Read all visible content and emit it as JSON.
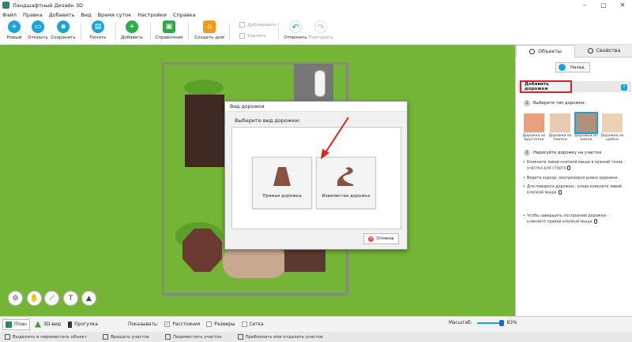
{
  "window": {
    "title": "Ландшафтный Дизайн 3D"
  },
  "menu": [
    "Файл",
    "Правка",
    "Добавить",
    "Вид",
    "Время суток",
    "Настройки",
    "Справка"
  ],
  "toolbar": {
    "new": "Новый",
    "open": "Открыть",
    "save": "Сохранить",
    "print": "Печать",
    "add": "Добавить",
    "reference": "Справочник",
    "create_house": "Создать дом",
    "duplicate": "Дублировать",
    "delete": "Удалить",
    "undo": "Отменить",
    "redo": "Повторить"
  },
  "dialog": {
    "title": "Вид дорожки",
    "heading": "Выберите вид дорожки:",
    "option_straight": "Прямая дорожка",
    "option_curved": "Извилистая дорожка",
    "cancel": "Отмена"
  },
  "right_panel": {
    "tab_objects": "Объекты",
    "tab_properties": "Свойства",
    "back": "Назад",
    "section_title": "Добавить дорожки",
    "step1": "Выберите тип дорожки:",
    "step2": "Нарисуйте дорожку на участке",
    "path_types": [
      {
        "label": "Дорожка из брусчатки",
        "color": "#e8a07a"
      },
      {
        "label": "Дорожка из плитки",
        "color": "#e6cbb0"
      },
      {
        "label": "Дорожка из камня",
        "color": "#b0917c"
      },
      {
        "label": "Дорожка из щебня",
        "color": "#ecd2b4"
      }
    ],
    "instr1": "Кликните левой кнопкой мыши в нужной точке участка для старта",
    "instr2": "Ведите курсор, контролируя длину дорожки",
    "instr3": "Для поворота дорожки - снова кликните левой кнопкой мыши",
    "instr4": "Чтобы завершить построение дорожки - кликните правой кнопкой мыши"
  },
  "viewbar": {
    "plan": "План",
    "view3d": "3D-вид",
    "walk": "Прогулка",
    "show": "Показывать:",
    "distances": "Расстояния",
    "sizes": "Размеры",
    "grid": "Сетка",
    "scale_label": "Масштаб:",
    "scale_value": "83%"
  },
  "statusbar": {
    "select_move": "Выделить и переместить объект",
    "rotate": "Вращать участок",
    "move_area": "Переместить участок",
    "zoom": "Приблизить или отдалить участок"
  },
  "colors": {
    "accent": "#1ca3d6",
    "grass": "#74b537",
    "highlight": "#e02020"
  }
}
